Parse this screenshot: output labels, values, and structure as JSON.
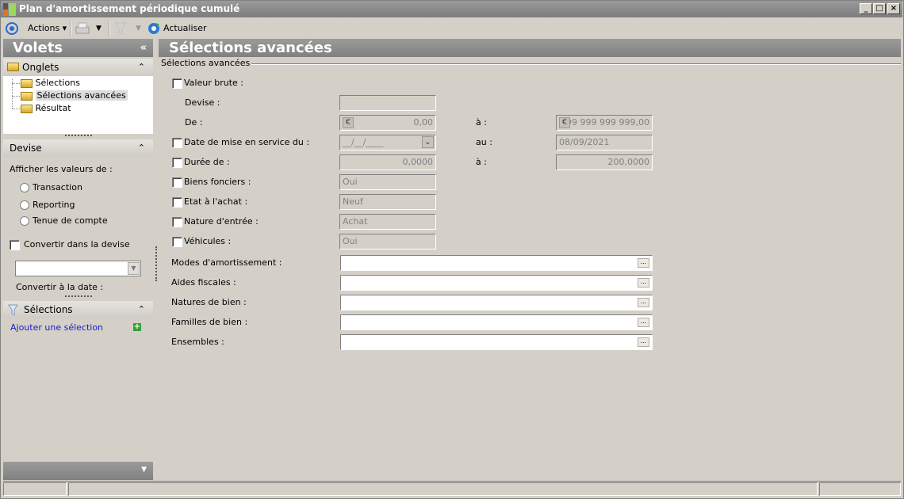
{
  "window": {
    "title": "Plan d'amortissement périodique cumulé",
    "minimize": "_",
    "maximize": "□",
    "close": "×"
  },
  "toolbar": {
    "actions": "Actions",
    "refresh": "Actualiser"
  },
  "left": {
    "title": "Volets",
    "collapse": "«",
    "tabs_section": {
      "title": "Onglets",
      "items": [
        "Sélections",
        "Sélections avancées",
        "Résultat"
      ],
      "selected": "Sélections avancées"
    },
    "devise": {
      "title": "Devise",
      "show_values_label": "Afficher les valeurs de :",
      "radios": [
        "Transaction",
        "Reporting",
        "Tenue de compte"
      ],
      "convert_checkbox": "Convertir dans la devise",
      "convert_date_label": "Convertir à la date :"
    },
    "selections": {
      "title": "Sélections",
      "add_link": "Ajouter une sélection"
    }
  },
  "main": {
    "title": "Sélections avancées",
    "group_label": "Sélections avancées",
    "valeur_brute": {
      "label": "Valeur brute :",
      "devise_label": "Devise :",
      "devise_value": "",
      "de_label": "De :",
      "de_value": "0,00",
      "a_label": "à :",
      "a_value": "999 999 999 999,00",
      "currency_symbol": "€"
    },
    "date_service": {
      "label": "Date de mise en service du :",
      "from_value": "__/__/____",
      "to_label": "au :",
      "to_value": "08/09/2021"
    },
    "duree": {
      "label": "Durée de :",
      "from_value": "0,0000",
      "to_label": "à :",
      "to_value": "200,0000"
    },
    "biens_fonciers": {
      "label": "Biens fonciers :",
      "value": "Oui"
    },
    "etat_achat": {
      "label": "Etat à l'achat :",
      "value": "Neuf"
    },
    "nature_entree": {
      "label": "Nature d'entrée :",
      "value": "Achat"
    },
    "vehicules": {
      "label": "Véhicules :",
      "value": "Oui"
    },
    "pickers": [
      {
        "label": "Modes d'amortissement :",
        "value": ""
      },
      {
        "label": "Aides fiscales :",
        "value": ""
      },
      {
        "label": "Natures de bien :",
        "value": ""
      },
      {
        "label": "Familles de bien :",
        "value": ""
      },
      {
        "label": "Ensembles :",
        "value": ""
      }
    ],
    "picker_button": "..."
  }
}
